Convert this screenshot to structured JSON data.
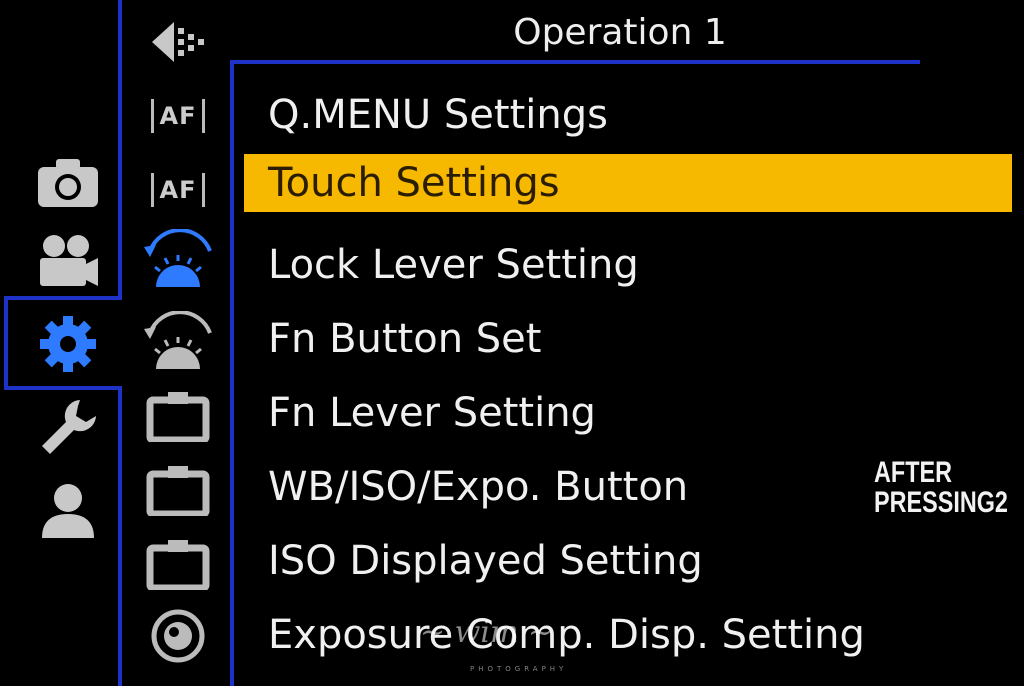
{
  "header": {
    "title": "Operation 1"
  },
  "categories": [
    {
      "icon": "camera-icon"
    },
    {
      "icon": "movie-camera-icon"
    },
    {
      "icon": "gear-icon",
      "active": true
    },
    {
      "icon": "wrench-icon"
    },
    {
      "icon": "person-icon"
    }
  ],
  "sub_tabs": [
    {
      "icon": "back-arrow-icon"
    },
    {
      "icon": "af-icon",
      "label": "AF"
    },
    {
      "icon": "af-icon",
      "label": "AF"
    },
    {
      "icon": "dial-icon",
      "active": true
    },
    {
      "icon": "dial-icon"
    },
    {
      "icon": "folder-icon"
    },
    {
      "icon": "folder-icon"
    },
    {
      "icon": "folder-icon"
    },
    {
      "icon": "lens-icon"
    }
  ],
  "menu": {
    "items": [
      {
        "label": "Q.MENU Settings"
      },
      {
        "label": "Touch Settings",
        "selected": true
      },
      {
        "label": "Lock Lever Setting"
      },
      {
        "label": "Fn Button Set"
      },
      {
        "label": "Fn Lever Setting"
      },
      {
        "label": "WB/ISO/Expo. Button"
      },
      {
        "label": "ISO Displayed Setting"
      },
      {
        "label": "Exposure Comp. Disp. Setting"
      }
    ]
  },
  "badge": {
    "line1": "AFTER",
    "line2": "PRESSING2"
  },
  "colors": {
    "frame": "#1e32c8",
    "active_icon": "#2f7bff",
    "selected_bg": "#f7b800"
  }
}
